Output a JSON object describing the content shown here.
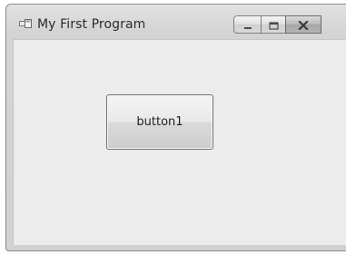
{
  "window": {
    "title": "My First Program",
    "icon": "app-form-icon",
    "caption_buttons": {
      "minimize_icon": "minimize-icon",
      "maximize_icon": "maximize-icon",
      "close_icon": "close-icon"
    }
  },
  "form": {
    "button1_label": "button1"
  },
  "colors": {
    "frame": "#d4d4d4",
    "client": "#ececec",
    "button_border": "#6f6f6f"
  }
}
